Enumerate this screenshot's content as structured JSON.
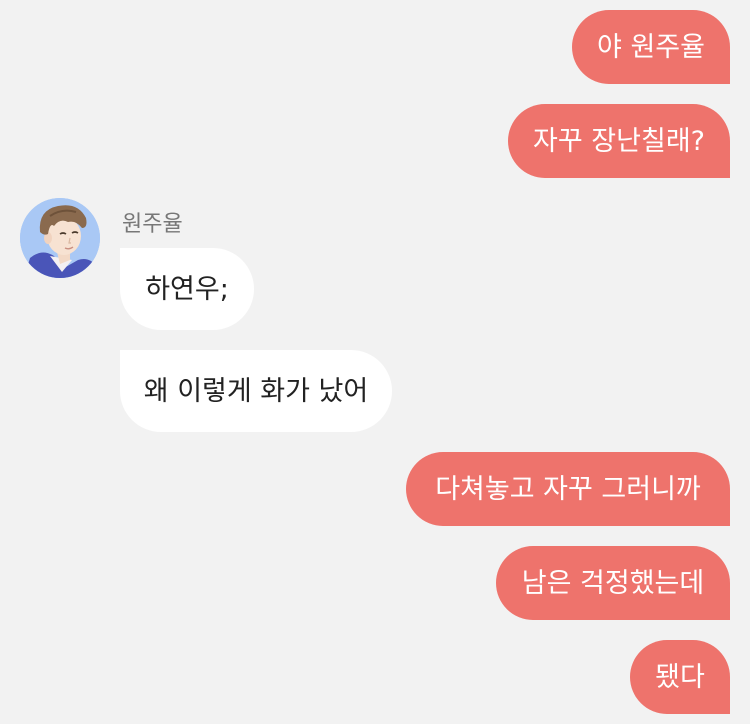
{
  "contact": {
    "name": "원주율",
    "avatar_icon": "profile-portrait"
  },
  "colors": {
    "background": "#f2f2f2",
    "outgoing_bubble": "#ee736c",
    "incoming_bubble": "#ffffff",
    "outgoing_text": "#ffffff",
    "incoming_text": "#222222"
  },
  "messages": [
    {
      "direction": "out",
      "text": "야 원주율"
    },
    {
      "direction": "out",
      "text": "자꾸 장난칠래?"
    },
    {
      "direction": "in",
      "text": "하연우;"
    },
    {
      "direction": "in",
      "text": "왜 이렇게 화가 났어"
    },
    {
      "direction": "out",
      "text": "다쳐놓고 자꾸 그러니까"
    },
    {
      "direction": "out",
      "text": "남은 걱정했는데"
    },
    {
      "direction": "out",
      "text": "됐다"
    }
  ]
}
